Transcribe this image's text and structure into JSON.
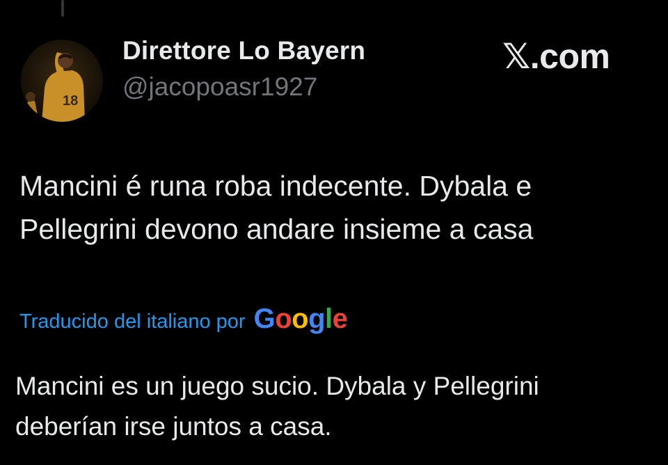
{
  "tweet": {
    "author_name": "Direttore Lo Bayern",
    "author_handle": "@jacopoasr1927",
    "site_logo": "𝕏.com",
    "avatar_icon": "profile-photo-player-18",
    "text_line1": "Mancini é runa roba indecente. Dybala e",
    "text_line2": "Pellegrini devono andare insieme a casa"
  },
  "translation": {
    "label": "Traducido del italiano por",
    "provider_letters": [
      "G",
      "o",
      "o",
      "g",
      "l",
      "e"
    ],
    "provider_colors": [
      "#4285f4",
      "#ea4335",
      "#fbbc05",
      "#4285f4",
      "#34a853",
      "#ea4335"
    ],
    "text_line1": "Mancini es un juego sucio. Dybala y Pellegrini",
    "text_line2": "deberían irse juntos a casa."
  },
  "colors": {
    "background": "#000000",
    "text_primary": "#e7e9ea",
    "text_secondary": "#71767b",
    "accent_link": "#1d9bf0"
  }
}
